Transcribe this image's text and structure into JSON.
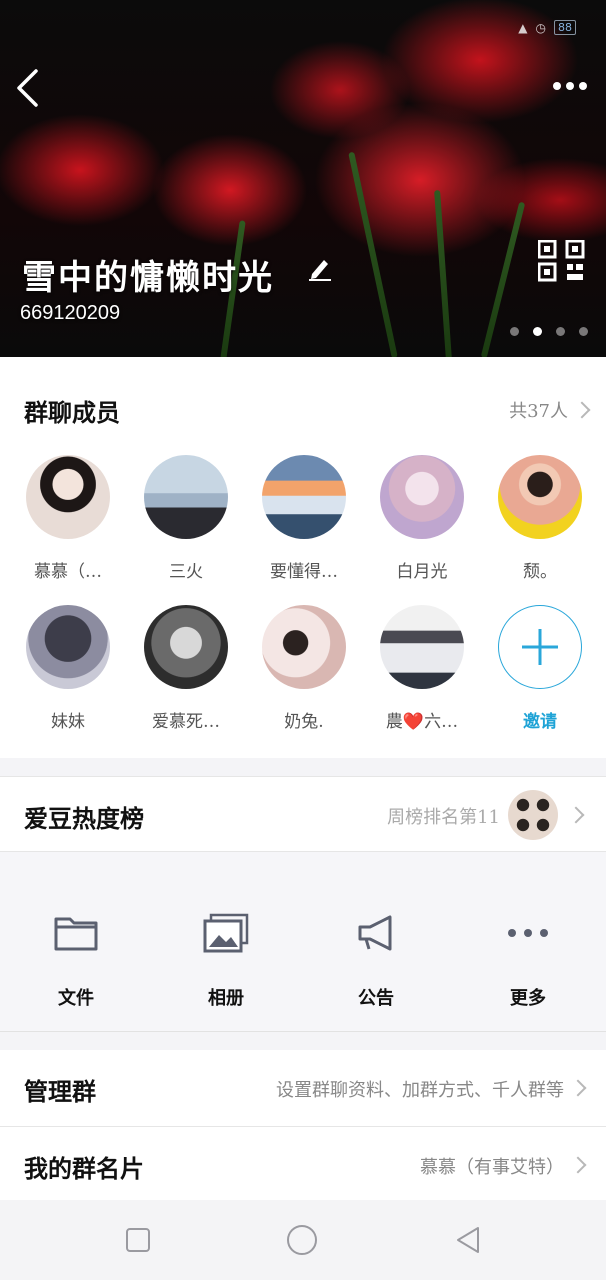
{
  "status_bar": {
    "battery": "88"
  },
  "header": {
    "group_name": "雪中的慵懒时光",
    "group_id": "669120209",
    "banner_dots": 4,
    "active_dot": 1
  },
  "members": {
    "title": "群聊成员",
    "count_label": "共37人",
    "items": [
      {
        "name": "慕慕（…",
        "color": "#d7c8c4"
      },
      {
        "name": "三火",
        "color": "#8fa6bb"
      },
      {
        "name": "要懂得…",
        "color": "#5f7fa3"
      },
      {
        "name": "白月光",
        "color": "#c9b7d6"
      },
      {
        "name": "颓。",
        "color": "#e8a08a"
      },
      {
        "name": "妹妹",
        "color": "#6e6e80"
      },
      {
        "name": "爱慕死…",
        "color": "#5a5a5a"
      },
      {
        "name": "奶兔.",
        "color": "#d8c6c4"
      },
      {
        "name": "農❤️六…",
        "color": "#8a9aa8"
      }
    ],
    "invite_label": "邀请"
  },
  "rank": {
    "title": "爱豆热度榜",
    "value": "周榜排名第11"
  },
  "actions": [
    {
      "label": "文件",
      "icon": "folder-icon"
    },
    {
      "label": "相册",
      "icon": "album-icon"
    },
    {
      "label": "公告",
      "icon": "megaphone-icon"
    },
    {
      "label": "更多",
      "icon": "more-dots-icon"
    }
  ],
  "settings": {
    "manage": {
      "label": "管理群",
      "value": "设置群聊资料、加群方式、千人群等"
    },
    "card": {
      "label": "我的群名片",
      "value": "慕慕（有事艾特）"
    }
  },
  "colors": {
    "accent": "#1fa3d6",
    "icon_gray": "#5b6070"
  }
}
